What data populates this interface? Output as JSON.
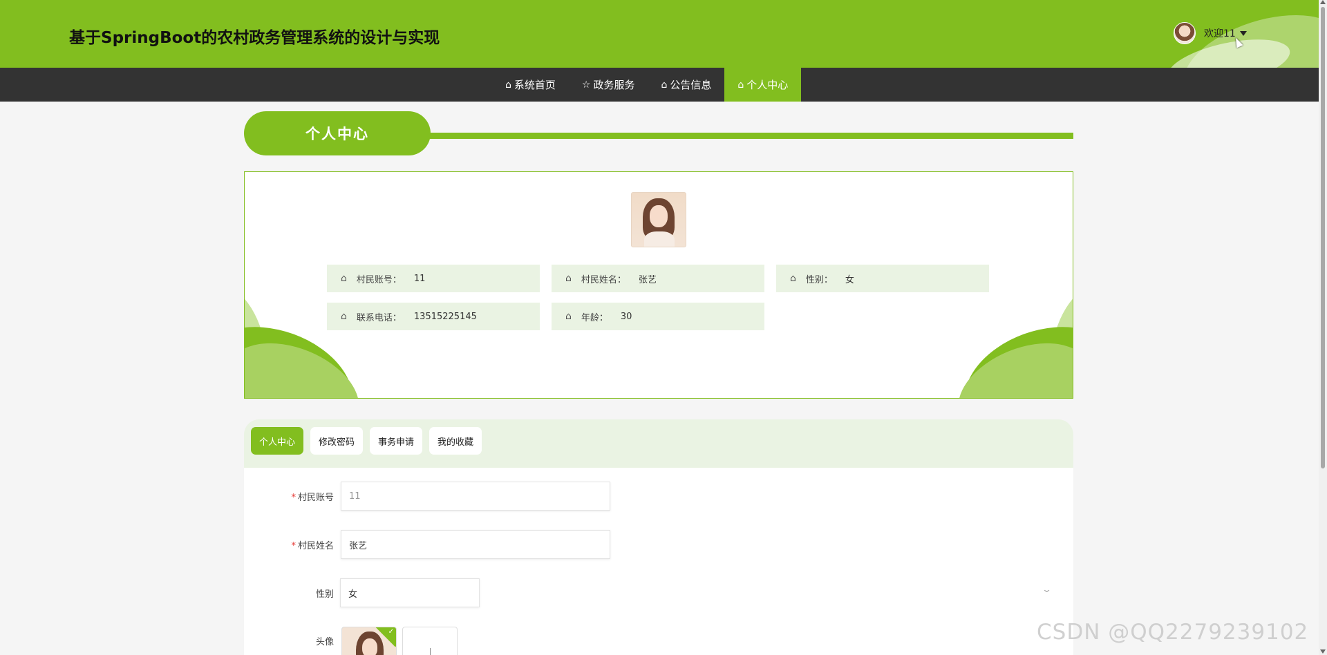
{
  "header": {
    "site_title": "基于SpringBoot的农村政务管理系统的设计与实现",
    "user_greeting": "欢迎11",
    "accent_color": "#82be1f"
  },
  "nav": {
    "items": [
      {
        "label": "系统首页",
        "icon": "home-icon"
      },
      {
        "label": "政务服务",
        "icon": "star-icon"
      },
      {
        "label": "公告信息",
        "icon": "bag-icon"
      },
      {
        "label": "个人中心",
        "icon": "home-icon",
        "active": true
      }
    ]
  },
  "section": {
    "title": "个人中心"
  },
  "profile": {
    "fields": [
      {
        "label": "村民账号：",
        "value": "11"
      },
      {
        "label": "村民姓名：",
        "value": "张艺"
      },
      {
        "label": "性别：",
        "value": "女"
      },
      {
        "label": "联系电话：",
        "value": "13515225145"
      },
      {
        "label": "年龄：",
        "value": "30"
      }
    ]
  },
  "tabs": [
    {
      "label": "个人中心",
      "active": true
    },
    {
      "label": "修改密码"
    },
    {
      "label": "事务申请"
    },
    {
      "label": "我的收藏"
    }
  ],
  "form": {
    "account_label": "村民账号",
    "account_value": "11",
    "name_label": "村民姓名",
    "name_value": "张艺",
    "gender_label": "性别",
    "gender_value": "女",
    "avatar_label": "头像",
    "required_mark": "*"
  },
  "watermark": "CSDN @QQ2279239102"
}
